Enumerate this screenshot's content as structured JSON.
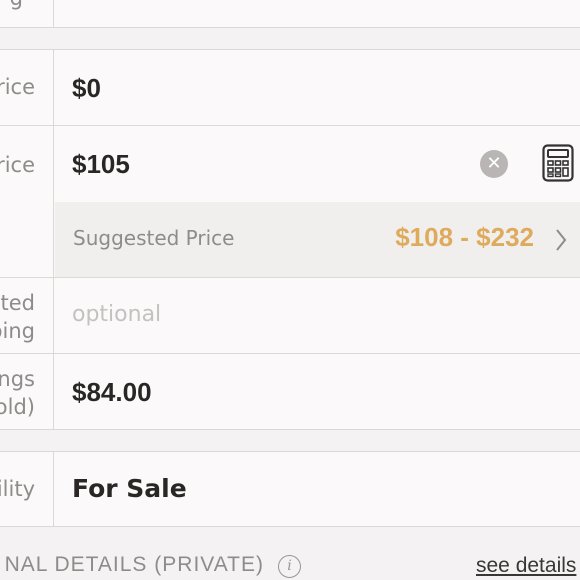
{
  "fields": {
    "top_partial": {
      "label": "g",
      "value": ""
    },
    "original_price": {
      "label": "Original Price",
      "label_visible": "rice",
      "value": "$0"
    },
    "listing_price": {
      "label": "Listing Price",
      "label_visible": "rice",
      "value": "$105",
      "suggested_label": "Suggested Price",
      "suggested_range": "$108 - $232",
      "clear_icon": "clear-circle-icon",
      "calculator_icon": "calculator-icon"
    },
    "discounted_shipping": {
      "label_line1": "ted",
      "label_line2": "ping",
      "placeholder": "optional"
    },
    "earnings": {
      "label_line1": "ngs",
      "label_line2": "old)",
      "value": "$84.00"
    },
    "availability": {
      "label": "ility",
      "value": "For Sale"
    }
  },
  "section": {
    "title": "NAL DETAILS (PRIVATE)",
    "info_icon": "info-icon",
    "link": "see details"
  },
  "colors": {
    "background": "#f4f2f2",
    "row": "#fbf9f9",
    "suggest_bg": "#f1efed",
    "accent": "#deaa5c",
    "label": "#8f8b8b",
    "value": "#2a2626"
  }
}
